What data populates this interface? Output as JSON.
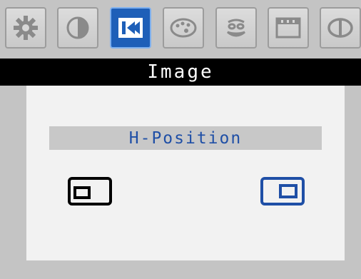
{
  "tabs": [
    {
      "icon": "sun-brightness-icon",
      "active": false
    },
    {
      "icon": "contrast-icon",
      "active": false
    },
    {
      "icon": "image-position-icon",
      "active": true
    },
    {
      "icon": "color-palette-icon",
      "active": false
    },
    {
      "icon": "face-icon",
      "active": false
    },
    {
      "icon": "osd-settings-icon",
      "active": false
    },
    {
      "icon": "reset-icon",
      "active": false
    }
  ],
  "menu": {
    "title": "Image",
    "item_label": "H-Position"
  },
  "colors": {
    "background": "#c4c4c4",
    "title_bar": "#000000",
    "active_tab": "#1e5fb8",
    "label_text": "#1f4fa6",
    "panel": "#f2f2f2"
  }
}
